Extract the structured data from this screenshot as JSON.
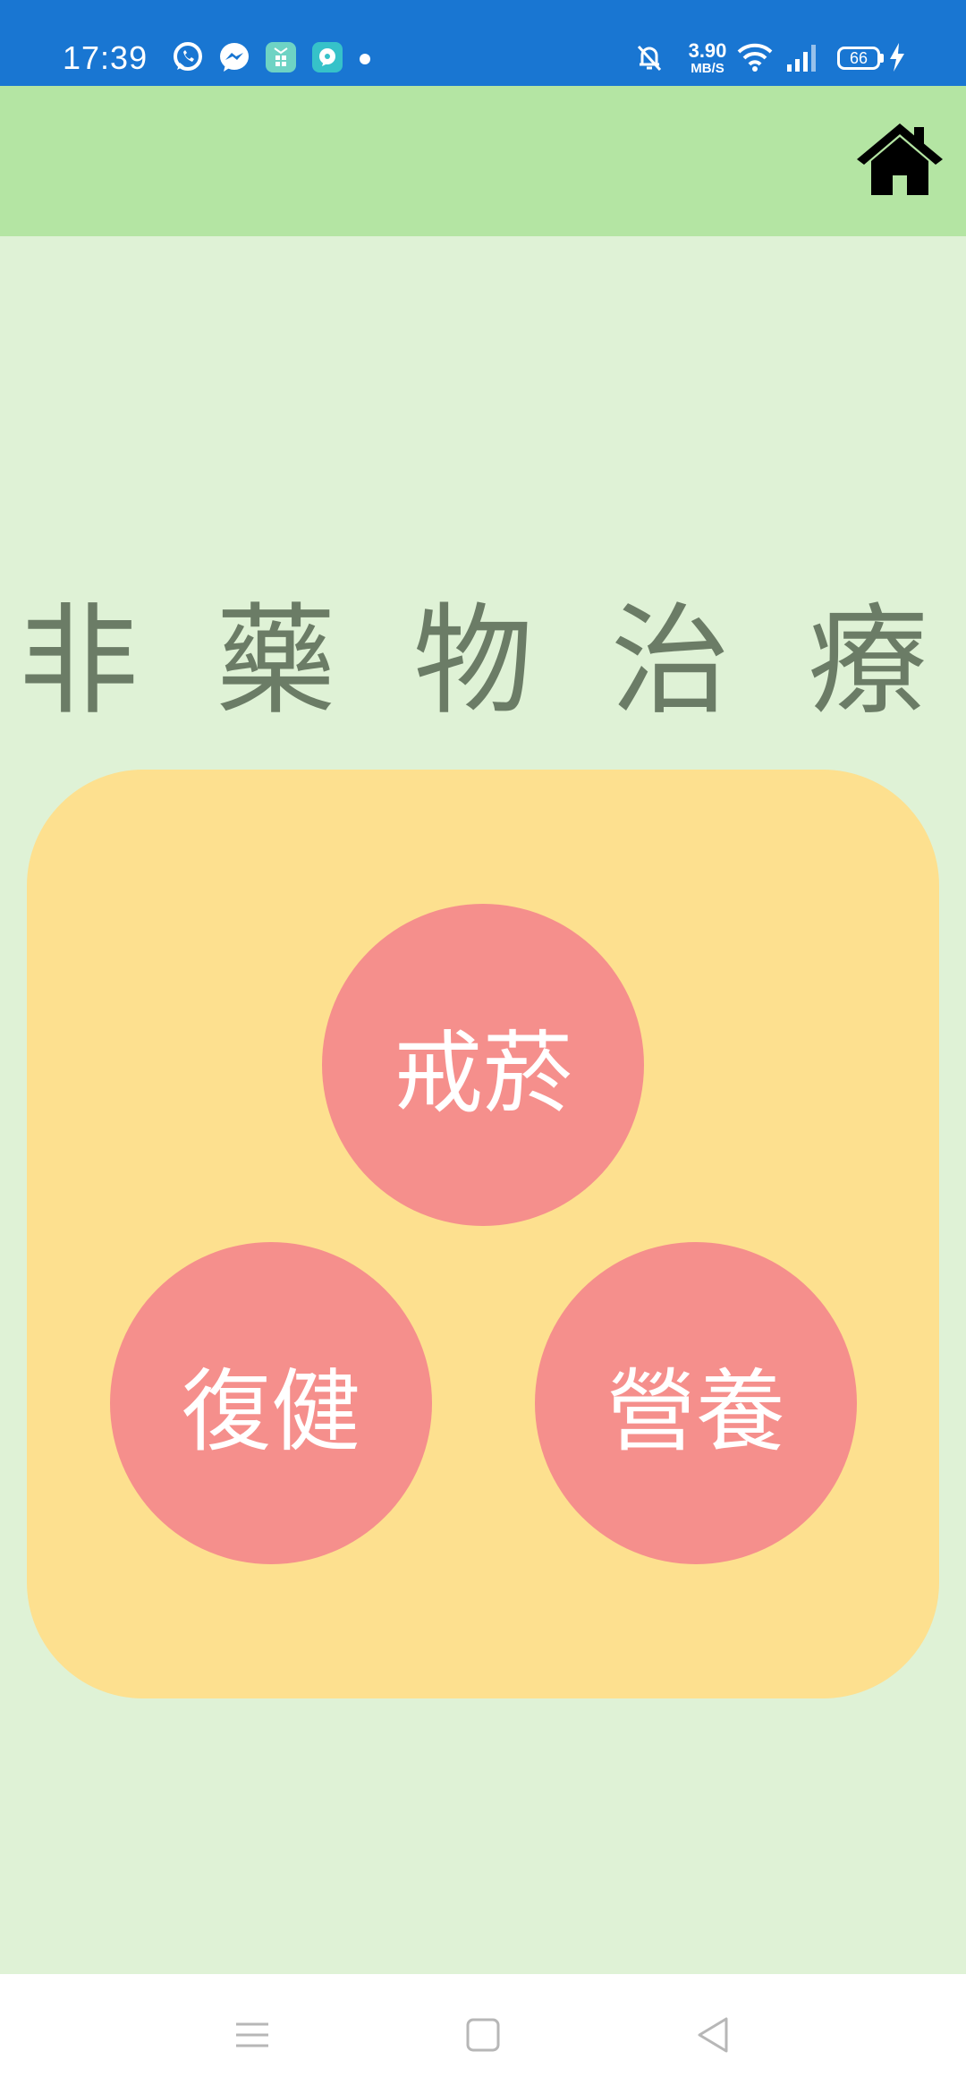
{
  "status_bar": {
    "time": "17:39",
    "speed_value": "3.90",
    "speed_unit": "MB/S",
    "battery": "66",
    "icons": [
      "whatsapp-icon",
      "messenger-icon",
      "app-icon",
      "chat-app-icon",
      "dot-icon",
      "mute-bell-icon",
      "wifi-icon",
      "signal-icon",
      "battery-icon",
      "charging-icon"
    ]
  },
  "toolbar": {
    "home_icon": "home-icon"
  },
  "page": {
    "title": "非 藥 物 治 療"
  },
  "options": {
    "quit_smoking": "戒菸",
    "rehab": "復健",
    "nutrition": "營養"
  },
  "nav": {
    "icons": [
      "menu-icon",
      "home-square-icon",
      "back-icon"
    ]
  },
  "colors": {
    "status_bar": "#1976d2",
    "toolbar": "#b4e5a3",
    "background": "#dff2d6",
    "card": "#fde08f",
    "circle": "#f58f8c",
    "title": "#6b7c66"
  }
}
